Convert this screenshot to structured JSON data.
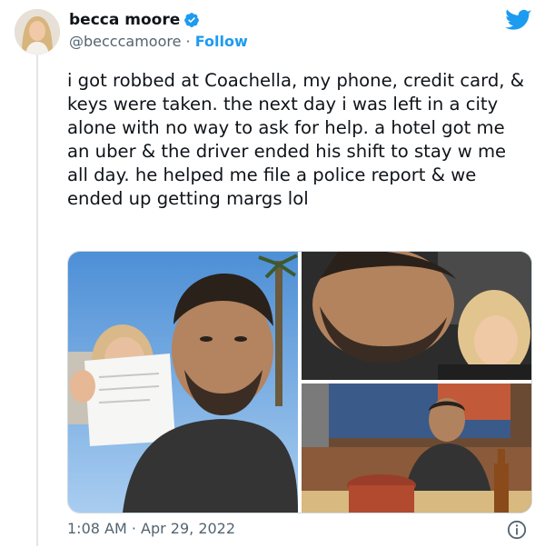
{
  "tweet": {
    "author_name": "becca moore",
    "handle": "@becccamoore",
    "separator": " · ",
    "follow_label": "Follow",
    "text": "i got robbed at Coachella, my phone, credit card, & keys were taken. the next day i was left in a city alone with no way to ask for help. a hotel got me an uber & the driver ended his shift to stay w me all day. he helped me file a police report & we ended up getting margs lol",
    "timestamp": "1:08 AM · Apr 29, 2022"
  },
  "icons": {
    "verified": "verified-badge-icon",
    "brand": "twitter-bird-icon",
    "info": "info-icon"
  },
  "colors": {
    "accent": "#1d9bf0",
    "text": "#0f1419",
    "muted": "#536471",
    "border": "#cfd9de"
  },
  "media": {
    "photo_count": 3
  }
}
